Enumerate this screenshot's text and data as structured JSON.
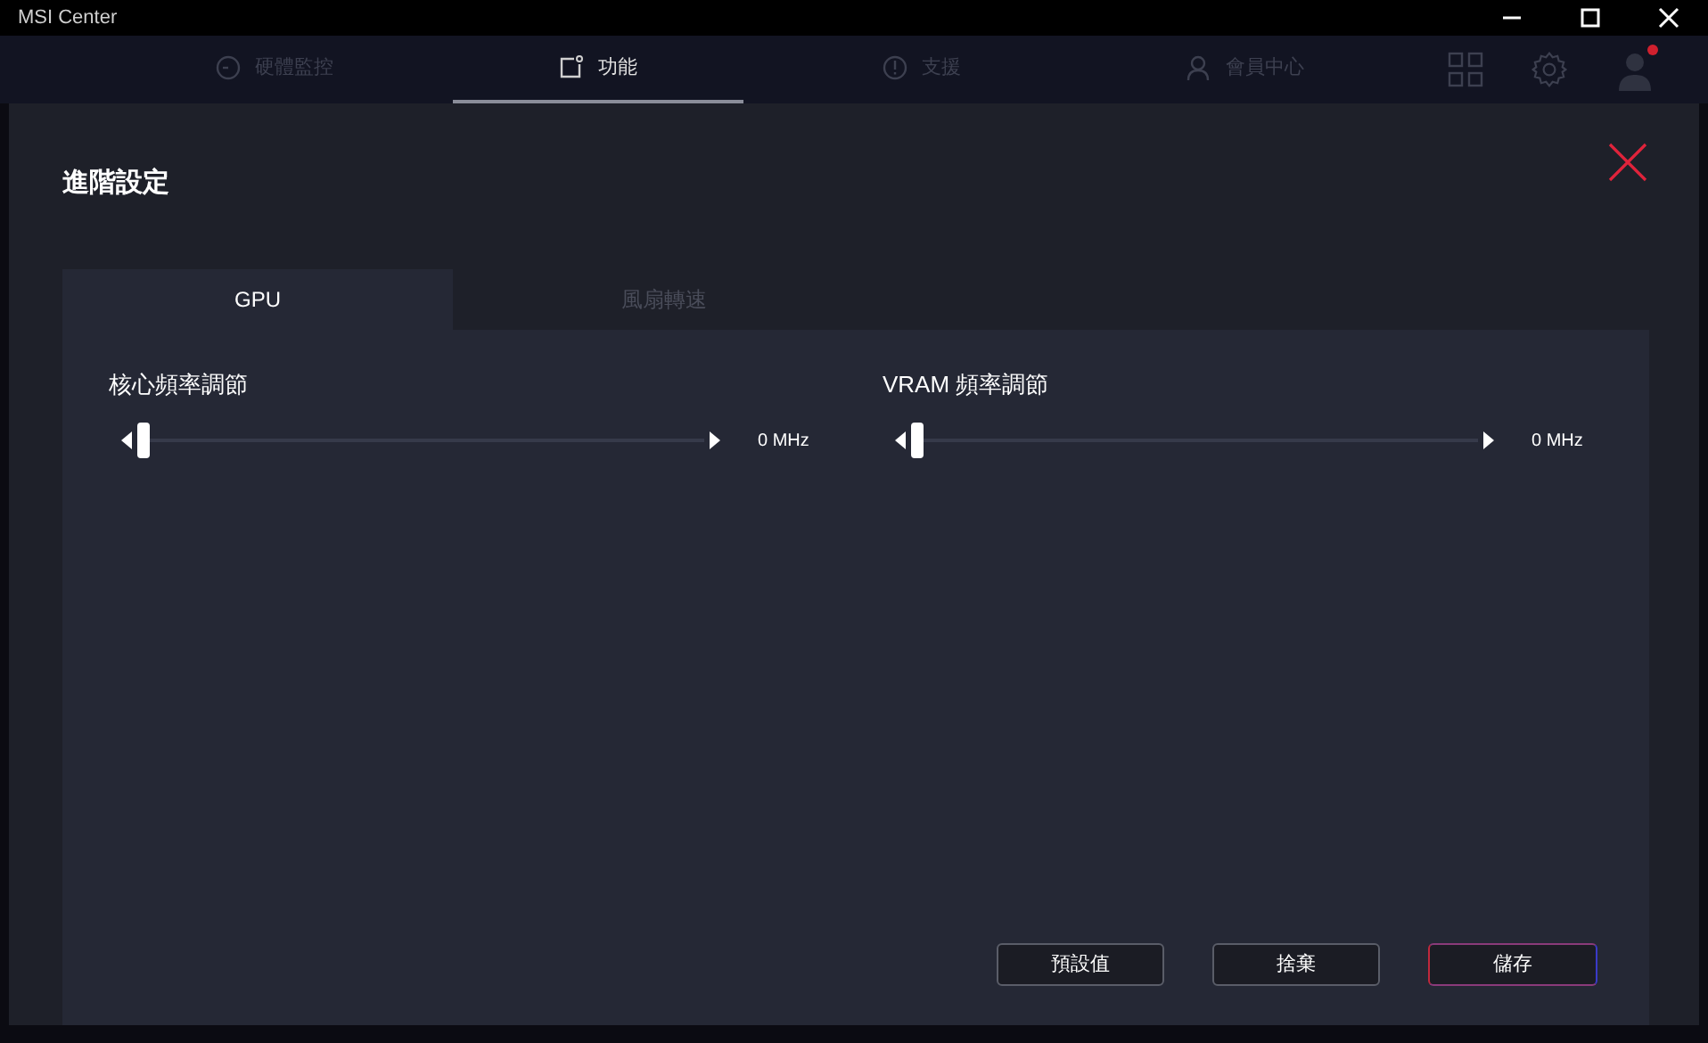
{
  "window": {
    "title": "MSI Center"
  },
  "nav_tabs": [
    {
      "label": "硬體監控",
      "selected": false
    },
    {
      "label": "功能",
      "selected": true
    },
    {
      "label": "支援",
      "selected": false
    },
    {
      "label": "會員中心",
      "selected": false
    }
  ],
  "profile": {
    "notification": true
  },
  "dialog": {
    "title": "進階設定",
    "tabs": [
      {
        "label": "GPU",
        "selected": true
      },
      {
        "label": "風扇轉速",
        "selected": false
      }
    ],
    "sliders": [
      {
        "label": "核心頻率調節",
        "level": 0,
        "reading": "0 MHz"
      },
      {
        "label": "VRAM 頻率調節",
        "level": 0,
        "reading": "0 MHz"
      }
    ],
    "buttons": [
      {
        "label": "預設值",
        "kind": "secondary"
      },
      {
        "label": "捨棄",
        "kind": "secondary"
      },
      {
        "label": "儲存",
        "kind": "primary"
      }
    ]
  }
}
